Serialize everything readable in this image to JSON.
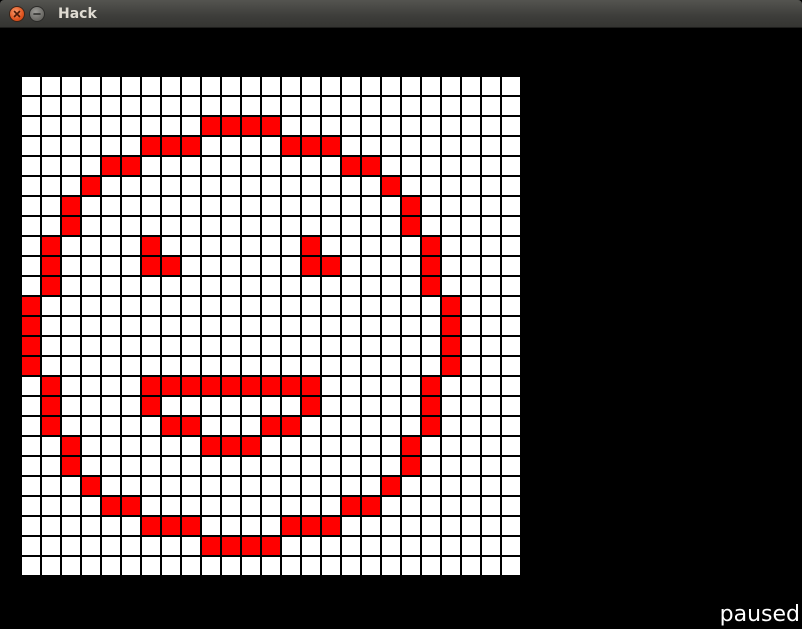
{
  "window": {
    "title": "Hack",
    "close_icon": "close-icon",
    "minimize_icon": "minimize-icon"
  },
  "status": {
    "text": "paused"
  },
  "grid": {
    "rows": 25,
    "cols": 25,
    "colors": {
      "background": "#000000",
      "dead": "#ffffff",
      "alive": "#ff0000",
      "gridline": "#000000"
    },
    "alive_cells": [
      [
        2,
        9
      ],
      [
        2,
        10
      ],
      [
        2,
        11
      ],
      [
        2,
        12
      ],
      [
        3,
        6
      ],
      [
        3,
        7
      ],
      [
        3,
        8
      ],
      [
        3,
        13
      ],
      [
        3,
        14
      ],
      [
        3,
        15
      ],
      [
        4,
        4
      ],
      [
        4,
        5
      ],
      [
        4,
        16
      ],
      [
        4,
        17
      ],
      [
        5,
        3
      ],
      [
        5,
        18
      ],
      [
        6,
        2
      ],
      [
        6,
        19
      ],
      [
        7,
        2
      ],
      [
        7,
        19
      ],
      [
        8,
        1
      ],
      [
        8,
        6
      ],
      [
        8,
        14
      ],
      [
        8,
        20
      ],
      [
        9,
        1
      ],
      [
        9,
        6
      ],
      [
        9,
        7
      ],
      [
        9,
        14
      ],
      [
        9,
        15
      ],
      [
        9,
        20
      ],
      [
        10,
        1
      ],
      [
        10,
        20
      ],
      [
        11,
        0
      ],
      [
        11,
        21
      ],
      [
        12,
        0
      ],
      [
        12,
        21
      ],
      [
        13,
        0
      ],
      [
        13,
        21
      ],
      [
        14,
        0
      ],
      [
        14,
        21
      ],
      [
        15,
        1
      ],
      [
        15,
        6
      ],
      [
        15,
        7
      ],
      [
        15,
        8
      ],
      [
        15,
        9
      ],
      [
        15,
        10
      ],
      [
        15,
        11
      ],
      [
        15,
        12
      ],
      [
        15,
        13
      ],
      [
        15,
        14
      ],
      [
        15,
        20
      ],
      [
        16,
        1
      ],
      [
        16,
        6
      ],
      [
        16,
        14
      ],
      [
        16,
        20
      ],
      [
        17,
        1
      ],
      [
        17,
        7
      ],
      [
        17,
        8
      ],
      [
        17,
        12
      ],
      [
        17,
        13
      ],
      [
        17,
        20
      ],
      [
        18,
        2
      ],
      [
        18,
        9
      ],
      [
        18,
        10
      ],
      [
        18,
        11
      ],
      [
        18,
        19
      ],
      [
        19,
        2
      ],
      [
        19,
        19
      ],
      [
        20,
        3
      ],
      [
        20,
        18
      ],
      [
        21,
        4
      ],
      [
        21,
        5
      ],
      [
        21,
        16
      ],
      [
        21,
        17
      ],
      [
        22,
        6
      ],
      [
        22,
        7
      ],
      [
        22,
        8
      ],
      [
        22,
        13
      ],
      [
        22,
        14
      ],
      [
        22,
        15
      ],
      [
        23,
        9
      ],
      [
        23,
        10
      ],
      [
        23,
        11
      ],
      [
        23,
        12
      ]
    ]
  }
}
